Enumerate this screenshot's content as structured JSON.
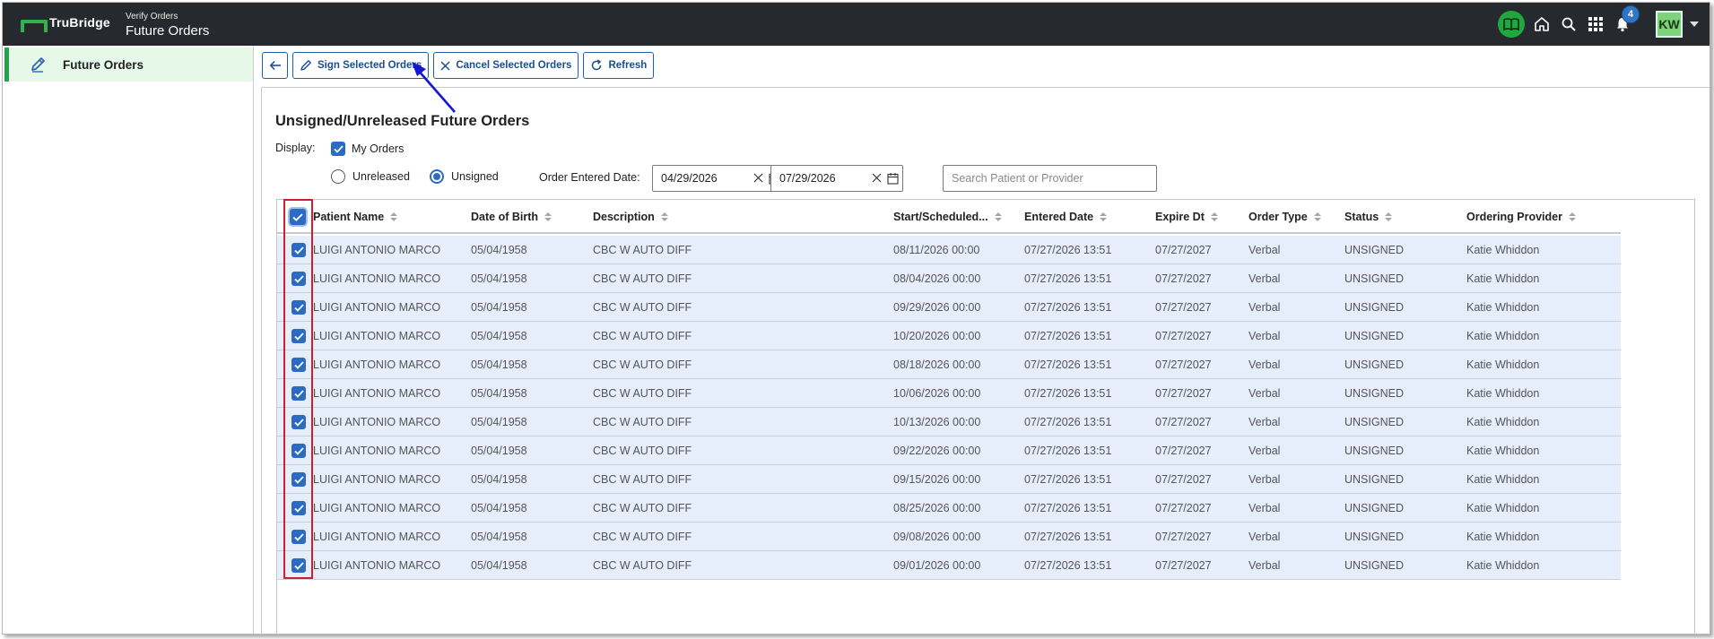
{
  "app": {
    "brand": "TruBridge",
    "subtitle": "Verify Orders",
    "title": "Future Orders"
  },
  "topbar": {
    "notification_count": "4",
    "user_initials": "KW",
    "icons": [
      "book-icon",
      "home-icon",
      "search-icon",
      "apps-grid-icon",
      "bell-icon",
      "caret-down-icon"
    ]
  },
  "sidebar": {
    "items": [
      {
        "label": "Future Orders",
        "icon": "pencil-icon",
        "active": true
      }
    ]
  },
  "toolbar": {
    "back_icon": "arrow-left-icon",
    "sign_label": "Sign Selected Orders",
    "cancel_label": "Cancel Selected Orders",
    "refresh_label": "Refresh"
  },
  "panel": {
    "title": "Unsigned/Unreleased Future Orders",
    "display_label": "Display:",
    "my_orders_label": "My Orders",
    "my_orders_checked": true,
    "unreleased_label": "Unreleased",
    "unsigned_label": "Unsigned",
    "selected_filter": "Unsigned",
    "order_entered_date_label": "Order Entered Date:",
    "date_from": "04/29/2026",
    "date_to": "07/29/2026",
    "search_placeholder": "Search Patient or Provider"
  },
  "table": {
    "columns": [
      "Patient Name",
      "Date of Birth",
      "Description",
      "Start/Scheduled...",
      "Entered Date",
      "Expire Dt",
      "Order Type",
      "Status",
      "Ordering Provider"
    ],
    "select_all_checked": true,
    "rows": [
      {
        "checked": true,
        "patient": "LUIGI ANTONIO MARCO",
        "dob": "05/04/1958",
        "description": "CBC W AUTO DIFF",
        "start": "08/11/2026 00:00",
        "entered": "07/27/2026 13:51",
        "expire": "07/27/2027",
        "type": "Verbal",
        "status": "UNSIGNED",
        "provider": "Katie Whiddon"
      },
      {
        "checked": true,
        "patient": "LUIGI ANTONIO MARCO",
        "dob": "05/04/1958",
        "description": "CBC W AUTO DIFF",
        "start": "08/04/2026 00:00",
        "entered": "07/27/2026 13:51",
        "expire": "07/27/2027",
        "type": "Verbal",
        "status": "UNSIGNED",
        "provider": "Katie Whiddon"
      },
      {
        "checked": true,
        "patient": "LUIGI ANTONIO MARCO",
        "dob": "05/04/1958",
        "description": "CBC W AUTO DIFF",
        "start": "09/29/2026 00:00",
        "entered": "07/27/2026 13:51",
        "expire": "07/27/2027",
        "type": "Verbal",
        "status": "UNSIGNED",
        "provider": "Katie Whiddon"
      },
      {
        "checked": true,
        "patient": "LUIGI ANTONIO MARCO",
        "dob": "05/04/1958",
        "description": "CBC W AUTO DIFF",
        "start": "10/20/2026 00:00",
        "entered": "07/27/2026 13:51",
        "expire": "07/27/2027",
        "type": "Verbal",
        "status": "UNSIGNED",
        "provider": "Katie Whiddon"
      },
      {
        "checked": true,
        "patient": "LUIGI ANTONIO MARCO",
        "dob": "05/04/1958",
        "description": "CBC W AUTO DIFF",
        "start": "08/18/2026 00:00",
        "entered": "07/27/2026 13:51",
        "expire": "07/27/2027",
        "type": "Verbal",
        "status": "UNSIGNED",
        "provider": "Katie Whiddon"
      },
      {
        "checked": true,
        "patient": "LUIGI ANTONIO MARCO",
        "dob": "05/04/1958",
        "description": "CBC W AUTO DIFF",
        "start": "10/06/2026 00:00",
        "entered": "07/27/2026 13:51",
        "expire": "07/27/2027",
        "type": "Verbal",
        "status": "UNSIGNED",
        "provider": "Katie Whiddon"
      },
      {
        "checked": true,
        "patient": "LUIGI ANTONIO MARCO",
        "dob": "05/04/1958",
        "description": "CBC W AUTO DIFF",
        "start": "10/13/2026 00:00",
        "entered": "07/27/2026 13:51",
        "expire": "07/27/2027",
        "type": "Verbal",
        "status": "UNSIGNED",
        "provider": "Katie Whiddon"
      },
      {
        "checked": true,
        "patient": "LUIGI ANTONIO MARCO",
        "dob": "05/04/1958",
        "description": "CBC W AUTO DIFF",
        "start": "09/22/2026 00:00",
        "entered": "07/27/2026 13:51",
        "expire": "07/27/2027",
        "type": "Verbal",
        "status": "UNSIGNED",
        "provider": "Katie Whiddon"
      },
      {
        "checked": true,
        "patient": "LUIGI ANTONIO MARCO",
        "dob": "05/04/1958",
        "description": "CBC W AUTO DIFF",
        "start": "09/15/2026 00:00",
        "entered": "07/27/2026 13:51",
        "expire": "07/27/2027",
        "type": "Verbal",
        "status": "UNSIGNED",
        "provider": "Katie Whiddon"
      },
      {
        "checked": true,
        "patient": "LUIGI ANTONIO MARCO",
        "dob": "05/04/1958",
        "description": "CBC W AUTO DIFF",
        "start": "08/25/2026 00:00",
        "entered": "07/27/2026 13:51",
        "expire": "07/27/2027",
        "type": "Verbal",
        "status": "UNSIGNED",
        "provider": "Katie Whiddon"
      },
      {
        "checked": true,
        "patient": "LUIGI ANTONIO MARCO",
        "dob": "05/04/1958",
        "description": "CBC W AUTO DIFF",
        "start": "09/08/2026 00:00",
        "entered": "07/27/2026 13:51",
        "expire": "07/27/2027",
        "type": "Verbal",
        "status": "UNSIGNED",
        "provider": "Katie Whiddon"
      },
      {
        "checked": true,
        "patient": "LUIGI ANTONIO MARCO",
        "dob": "05/04/1958",
        "description": "CBC W AUTO DIFF",
        "start": "09/01/2026 00:00",
        "entered": "07/27/2026 13:51",
        "expire": "07/27/2027",
        "type": "Verbal",
        "status": "UNSIGNED",
        "provider": "Katie Whiddon"
      }
    ]
  },
  "colors": {
    "topbar": "#262a2e",
    "brand_green": "#27a14a",
    "accent_blue": "#2c6bc4",
    "row_bg": "#e5eefa",
    "highlight_red": "#d0202b"
  }
}
